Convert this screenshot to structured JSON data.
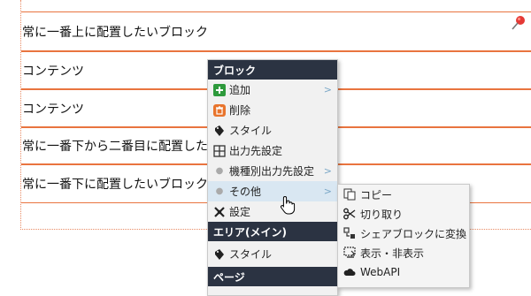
{
  "blocks": [
    {
      "label": "常に一番上に配置したいブロック"
    },
    {
      "label": "コンテンツ"
    },
    {
      "label": "コンテンツ"
    },
    {
      "label": "常に一番下から二番目に配置したいブロック"
    },
    {
      "label": "常に一番下に配置したいブロック"
    }
  ],
  "context_menu": {
    "header_block": "ブロック",
    "items": [
      {
        "label": "追加",
        "icon": "add-icon",
        "submenu": true
      },
      {
        "label": "削除",
        "icon": "delete-icon",
        "submenu": false
      },
      {
        "label": "スタイル",
        "icon": "style-icon",
        "submenu": false
      },
      {
        "label": "出力先設定",
        "icon": "output-icon",
        "submenu": false
      },
      {
        "label": "機種別出力先設定",
        "icon": "dot",
        "submenu": true
      },
      {
        "label": "その他",
        "icon": "dot",
        "submenu": true
      },
      {
        "label": "設定",
        "icon": "settings-icon",
        "submenu": false
      }
    ],
    "header_area": "エリア(メイン)",
    "area_items": [
      {
        "label": "スタイル",
        "icon": "style-icon"
      }
    ],
    "header_page": "ページ",
    "arrow": ">"
  },
  "submenu_other": {
    "items": [
      {
        "label": "コピー",
        "icon": "copy-icon"
      },
      {
        "label": "切り取り",
        "icon": "cut-icon"
      },
      {
        "label": "シェアブロックに変換",
        "icon": "share-block-icon"
      },
      {
        "label": "表示・非表示",
        "icon": "visibility-icon"
      },
      {
        "label": "WebAPI",
        "icon": "cloud-icon"
      }
    ]
  },
  "colors": {
    "block_border": "#e9743f",
    "menu_header_bg": "#2b3342",
    "highlight": "#d9e7f2"
  }
}
